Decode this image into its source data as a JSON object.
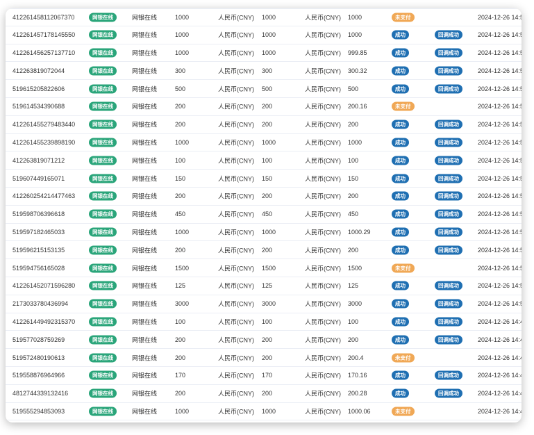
{
  "colors": {
    "pay_tag": "#2aa57a",
    "success": "#1f6fb2",
    "unpaid": "#f0a856"
  },
  "rows": [
    {
      "order": "412261458112067370",
      "pay_tag": "网银在线",
      "channel": "网银在线",
      "amount": "1000",
      "currency1": "人民币(CNY)",
      "amount2": "1000",
      "currency2": "人民币(CNY)",
      "amount3": "1000",
      "status": "未支付",
      "status_type": "unpaid",
      "callback": "",
      "time": "2024-12-26 14:5"
    },
    {
      "order": "412261457178145550",
      "pay_tag": "网银在线",
      "channel": "网银在线",
      "amount": "1000",
      "currency1": "人民币(CNY)",
      "amount2": "1000",
      "currency2": "人民币(CNY)",
      "amount3": "1000",
      "status": "成功",
      "status_type": "success",
      "callback": "回调成功",
      "time": "2024-12-26 14:5"
    },
    {
      "order": "412261456257137710",
      "pay_tag": "网银在线",
      "channel": "网银在线",
      "amount": "1000",
      "currency1": "人民币(CNY)",
      "amount2": "1000",
      "currency2": "人民币(CNY)",
      "amount3": "999.85",
      "status": "成功",
      "status_type": "success",
      "callback": "回调成功",
      "time": "2024-12-26 14:5"
    },
    {
      "order": "412263819072044",
      "pay_tag": "网银在线",
      "channel": "网银在线",
      "amount": "300",
      "currency1": "人民币(CNY)",
      "amount2": "300",
      "currency2": "人民币(CNY)",
      "amount3": "300.32",
      "status": "成功",
      "status_type": "success",
      "callback": "回调成功",
      "time": "2024-12-26 14:5"
    },
    {
      "order": "519615205822606",
      "pay_tag": "网银在线",
      "channel": "网银在线",
      "amount": "500",
      "currency1": "人民币(CNY)",
      "amount2": "500",
      "currency2": "人民币(CNY)",
      "amount3": "500",
      "status": "成功",
      "status_type": "success",
      "callback": "回调成功",
      "time": "2024-12-26 14:5"
    },
    {
      "order": "519614534390688",
      "pay_tag": "网银在线",
      "channel": "网银在线",
      "amount": "200",
      "currency1": "人民币(CNY)",
      "amount2": "200",
      "currency2": "人民币(CNY)",
      "amount3": "200.16",
      "status": "未支付",
      "status_type": "unpaid",
      "callback": "",
      "time": "2024-12-26 14:5"
    },
    {
      "order": "412261455279483440",
      "pay_tag": "网银在线",
      "channel": "网银在线",
      "amount": "200",
      "currency1": "人民币(CNY)",
      "amount2": "200",
      "currency2": "人民币(CNY)",
      "amount3": "200",
      "status": "成功",
      "status_type": "success",
      "callback": "回调成功",
      "time": "2024-12-26 14:5"
    },
    {
      "order": "412261455239898190",
      "pay_tag": "网银在线",
      "channel": "网银在线",
      "amount": "1000",
      "currency1": "人民币(CNY)",
      "amount2": "1000",
      "currency2": "人民币(CNY)",
      "amount3": "1000",
      "status": "成功",
      "status_type": "success",
      "callback": "回调成功",
      "time": "2024-12-26 14:5"
    },
    {
      "order": "412263819071212",
      "pay_tag": "网银在线",
      "channel": "网银在线",
      "amount": "100",
      "currency1": "人民币(CNY)",
      "amount2": "100",
      "currency2": "人民币(CNY)",
      "amount3": "100",
      "status": "成功",
      "status_type": "success",
      "callback": "回调成功",
      "time": "2024-12-26 14:5"
    },
    {
      "order": "519607449165071",
      "pay_tag": "网银在线",
      "channel": "网银在线",
      "amount": "150",
      "currency1": "人民币(CNY)",
      "amount2": "150",
      "currency2": "人民币(CNY)",
      "amount3": "150",
      "status": "成功",
      "status_type": "success",
      "callback": "回调成功",
      "time": "2024-12-26 14:5"
    },
    {
      "order": "412260254214477463",
      "pay_tag": "网银在线",
      "channel": "网银在线",
      "amount": "200",
      "currency1": "人民币(CNY)",
      "amount2": "200",
      "currency2": "人民币(CNY)",
      "amount3": "200",
      "status": "成功",
      "status_type": "success",
      "callback": "回调成功",
      "time": "2024-12-26 14:5"
    },
    {
      "order": "519598706396618",
      "pay_tag": "网银在线",
      "channel": "网银在线",
      "amount": "450",
      "currency1": "人民币(CNY)",
      "amount2": "450",
      "currency2": "人民币(CNY)",
      "amount3": "450",
      "status": "成功",
      "status_type": "success",
      "callback": "回调成功",
      "time": "2024-12-26 14:5"
    },
    {
      "order": "519597182465033",
      "pay_tag": "网银在线",
      "channel": "网银在线",
      "amount": "1000",
      "currency1": "人民币(CNY)",
      "amount2": "1000",
      "currency2": "人民币(CNY)",
      "amount3": "1000.29",
      "status": "成功",
      "status_type": "success",
      "callback": "回调成功",
      "time": "2024-12-26 14:5"
    },
    {
      "order": "519596215153135",
      "pay_tag": "网银在线",
      "channel": "网银在线",
      "amount": "200",
      "currency1": "人民币(CNY)",
      "amount2": "200",
      "currency2": "人民币(CNY)",
      "amount3": "200",
      "status": "成功",
      "status_type": "success",
      "callback": "回调成功",
      "time": "2024-12-26 14:5"
    },
    {
      "order": "519594756165028",
      "pay_tag": "网银在线",
      "channel": "网银在线",
      "amount": "1500",
      "currency1": "人民币(CNY)",
      "amount2": "1500",
      "currency2": "人民币(CNY)",
      "amount3": "1500",
      "status": "未支付",
      "status_type": "unpaid",
      "callback": "",
      "time": "2024-12-26 14:5"
    },
    {
      "order": "412261452071596280",
      "pay_tag": "网银在线",
      "channel": "网银在线",
      "amount": "125",
      "currency1": "人民币(CNY)",
      "amount2": "125",
      "currency2": "人民币(CNY)",
      "amount3": "125",
      "status": "成功",
      "status_type": "success",
      "callback": "回调成功",
      "time": "2024-12-26 14:5"
    },
    {
      "order": "2173033780436994",
      "pay_tag": "网银在线",
      "channel": "网银在线",
      "amount": "3000",
      "currency1": "人民币(CNY)",
      "amount2": "3000",
      "currency2": "人民币(CNY)",
      "amount3": "3000",
      "status": "成功",
      "status_type": "success",
      "callback": "回调成功",
      "time": "2024-12-26 14:5"
    },
    {
      "order": "412261449492315370",
      "pay_tag": "网银在线",
      "channel": "网银在线",
      "amount": "100",
      "currency1": "人民币(CNY)",
      "amount2": "100",
      "currency2": "人民币(CNY)",
      "amount3": "100",
      "status": "成功",
      "status_type": "success",
      "callback": "回调成功",
      "time": "2024-12-26 14:4"
    },
    {
      "order": "519577028759269",
      "pay_tag": "网银在线",
      "channel": "网银在线",
      "amount": "200",
      "currency1": "人民币(CNY)",
      "amount2": "200",
      "currency2": "人民币(CNY)",
      "amount3": "200",
      "status": "成功",
      "status_type": "success",
      "callback": "回调成功",
      "time": "2024-12-26 14:4"
    },
    {
      "order": "519572480190613",
      "pay_tag": "网银在线",
      "channel": "网银在线",
      "amount": "200",
      "currency1": "人民币(CNY)",
      "amount2": "200",
      "currency2": "人民币(CNY)",
      "amount3": "200.4",
      "status": "未支付",
      "status_type": "unpaid",
      "callback": "",
      "time": "2024-12-26 14:4"
    },
    {
      "order": "519558876964966",
      "pay_tag": "网银在线",
      "channel": "网银在线",
      "amount": "170",
      "currency1": "人民币(CNY)",
      "amount2": "170",
      "currency2": "人民币(CNY)",
      "amount3": "170.16",
      "status": "成功",
      "status_type": "success",
      "callback": "回调成功",
      "time": "2024-12-26 14:4"
    },
    {
      "order": "4812744339132416",
      "pay_tag": "网银在线",
      "channel": "网银在线",
      "amount": "200",
      "currency1": "人民币(CNY)",
      "amount2": "200",
      "currency2": "人民币(CNY)",
      "amount3": "200.28",
      "status": "成功",
      "status_type": "success",
      "callback": "回调成功",
      "time": "2024-12-26 14:4"
    },
    {
      "order": "519555294853093",
      "pay_tag": "网银在线",
      "channel": "网银在线",
      "amount": "1000",
      "currency1": "人民币(CNY)",
      "amount2": "1000",
      "currency2": "人民币(CNY)",
      "amount3": "1000.06",
      "status": "未支付",
      "status_type": "unpaid",
      "callback": "",
      "time": "2024-12-26 14:4"
    }
  ]
}
